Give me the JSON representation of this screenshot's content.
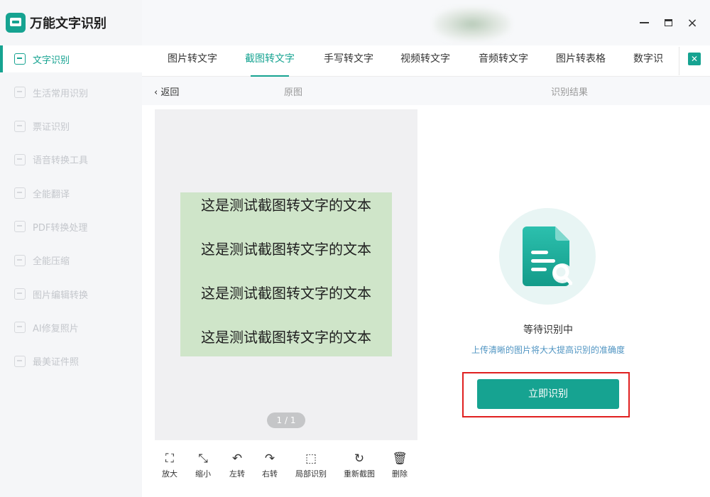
{
  "app": {
    "title": "万能文字识别",
    "logo_icon": "scanner-icon"
  },
  "sidebar": {
    "items": [
      {
        "label": "文字识别",
        "icon": "text-scan-icon",
        "active": true
      },
      {
        "label": "生活常用识别",
        "icon": "life-scan-icon"
      },
      {
        "label": "票证识别",
        "icon": "ticket-scan-icon"
      },
      {
        "label": "语音转换工具",
        "icon": "voice-icon"
      },
      {
        "label": "全能翻译",
        "icon": "translate-icon"
      },
      {
        "label": "PDF转换处理",
        "icon": "pdf-icon"
      },
      {
        "label": "全能压缩",
        "icon": "compress-icon"
      },
      {
        "label": "图片编辑转换",
        "icon": "image-edit-icon"
      },
      {
        "label": "AI修复照片",
        "icon": "ai-photo-icon"
      },
      {
        "label": "最美证件照",
        "icon": "id-photo-icon"
      }
    ]
  },
  "window": {
    "minimize": "minimize-icon",
    "maximize": "maximize-icon",
    "close": "×"
  },
  "tabs": [
    {
      "label": "图片转文字"
    },
    {
      "label": "截图转文字",
      "active": true
    },
    {
      "label": "手写转文字"
    },
    {
      "label": "视频转文字"
    },
    {
      "label": "音频转文字"
    },
    {
      "label": "图片转表格"
    },
    {
      "label": "数字识"
    }
  ],
  "subheader": {
    "back": "返回",
    "original": "原图",
    "result": "识别结果"
  },
  "preview": {
    "lines": [
      "这是测试截图转文字的文本",
      "这是测试截图转文字的文本",
      "这是测试截图转文字的文本",
      "这是测试截图转文字的文本"
    ],
    "pager": "1 / 1"
  },
  "toolbar": [
    {
      "label": "放大",
      "icon": "zoom-in-icon",
      "glyph": "⛶"
    },
    {
      "label": "缩小",
      "icon": "zoom-out-icon",
      "glyph": "⤡"
    },
    {
      "label": "左转",
      "icon": "rotate-left-icon",
      "glyph": "↶"
    },
    {
      "label": "右转",
      "icon": "rotate-right-icon",
      "glyph": "↷"
    },
    {
      "label": "局部识别",
      "icon": "crop-icon",
      "glyph": "⬚"
    },
    {
      "label": "重新截图",
      "icon": "refresh-icon",
      "glyph": "↻"
    },
    {
      "label": "删除",
      "icon": "trash-icon",
      "glyph": "🗑"
    }
  ],
  "result": {
    "status": "等待识别中",
    "hint": "上传清晰的图片将大大提高识别的准确度",
    "button": "立即识别"
  },
  "colors": {
    "accent": "#16a391",
    "highlight_border": "#e02020",
    "preview_bg": "#cfe5c9"
  }
}
